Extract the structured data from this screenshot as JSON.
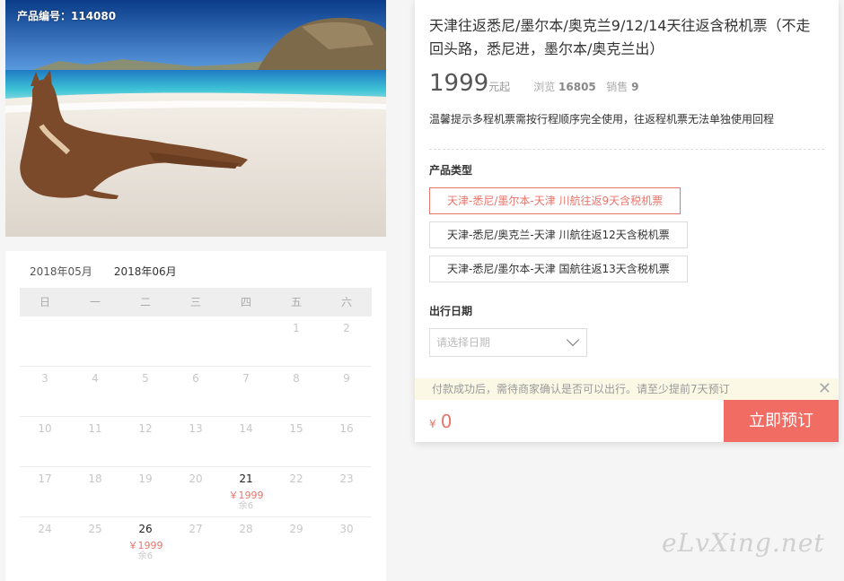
{
  "hero": {
    "product_code": "产品编号：114080",
    "image": "kangaroo-on-beach"
  },
  "calendar": {
    "tabs": [
      "2018年05月",
      "2018年06月"
    ],
    "active_tab": "2018年06月",
    "weekdays": [
      "日",
      "一",
      "二",
      "三",
      "四",
      "五",
      "六"
    ],
    "weeks": [
      [
        {
          "day": ""
        },
        {
          "day": ""
        },
        {
          "day": ""
        },
        {
          "day": ""
        },
        {
          "day": ""
        },
        {
          "day": "1"
        },
        {
          "day": "2"
        }
      ],
      [
        {
          "day": "3"
        },
        {
          "day": "4"
        },
        {
          "day": "5"
        },
        {
          "day": "6"
        },
        {
          "day": "7"
        },
        {
          "day": "8"
        },
        {
          "day": "9"
        }
      ],
      [
        {
          "day": "10"
        },
        {
          "day": "11"
        },
        {
          "day": "12"
        },
        {
          "day": "13"
        },
        {
          "day": "14"
        },
        {
          "day": "15"
        },
        {
          "day": "16"
        }
      ],
      [
        {
          "day": "17"
        },
        {
          "day": "18"
        },
        {
          "day": "19"
        },
        {
          "day": "20"
        },
        {
          "day": "21",
          "price": "￥1999",
          "left": "余6"
        },
        {
          "day": "22"
        },
        {
          "day": "23"
        }
      ],
      [
        {
          "day": "24"
        },
        {
          "day": "25"
        },
        {
          "day": "26",
          "price": "￥1999",
          "left": "余6"
        },
        {
          "day": "27"
        },
        {
          "day": "28"
        },
        {
          "day": "29"
        },
        {
          "day": "30"
        }
      ]
    ]
  },
  "product": {
    "title": "天津往返悉尼/墨尔本/奥克兰9/12/14天往返含税机票（不走回头路，悉尼进，墨尔本/奥克兰出）",
    "price": "1999",
    "price_unit": "元起",
    "views_label": "浏览",
    "views": "16805",
    "sales_label": "销售",
    "sales": "9",
    "notice": "温馨提示多程机票需按行程顺序完全使用，往返程机票无法单独使用回程",
    "type_label": "产品类型",
    "options": [
      "天津-悉尼/墨尔本-天津 川航往返9天含税机票",
      "天津-悉尼/奥克兰-天津 川航往返12天含税机票",
      "天津-悉尼/墨尔本-天津 国航往返13天含税机票"
    ],
    "selected_option": 0,
    "date_label": "出行日期",
    "date_placeholder": "请选择日期",
    "tip": "付款成功后，需待商家确认是否可以出行。请至少提前7天预订",
    "total_currency": "¥",
    "total_amount": "0",
    "book_label": "立即预订"
  },
  "watermark": "eLvXing.net",
  "colors": {
    "accent": "#e8756b",
    "book_button": "#f16d63",
    "tip_bg": "#fcf8e6"
  }
}
